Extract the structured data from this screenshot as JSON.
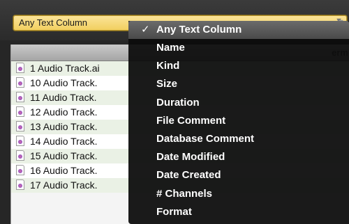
{
  "filter_select": {
    "value": "Any Text Column",
    "arrow_icon": "chevron-down-icon"
  },
  "list": {
    "header_partial": "erm",
    "rows": [
      {
        "name": "1 Audio Track.ai",
        "icon": "audio-file-icon"
      },
      {
        "name": "10 Audio Track.",
        "icon": "audio-file-icon"
      },
      {
        "name": "11 Audio Track.",
        "icon": "audio-file-icon"
      },
      {
        "name": "12 Audio Track.",
        "icon": "audio-file-icon"
      },
      {
        "name": "13 Audio Track.",
        "icon": "audio-file-icon"
      },
      {
        "name": "14 Audio Track.",
        "icon": "audio-file-icon"
      },
      {
        "name": "15 Audio Track.",
        "icon": "audio-file-icon"
      },
      {
        "name": "16 Audio Track.",
        "icon": "audio-file-icon"
      },
      {
        "name": "17 Audio Track.",
        "icon": "audio-file-icon"
      }
    ]
  },
  "dropdown_menu": {
    "checkmark": "✓",
    "selected_index": 0,
    "items": [
      "Any Text Column",
      "Name",
      "Kind",
      "Size",
      "Duration",
      "File Comment",
      "Database Comment",
      "Date Modified",
      "Date Created",
      "# Channels",
      "Format"
    ]
  },
  "colors": {
    "select_fill": "#f1cf5d",
    "menu_background": "#0c0c0c",
    "row_alt": "#eaf1e5"
  }
}
